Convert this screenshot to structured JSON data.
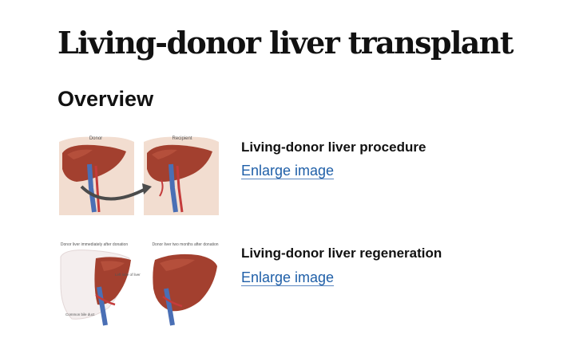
{
  "page": {
    "title": "Living-donor liver transplant",
    "section_heading": "Overview"
  },
  "figures": [
    {
      "caption": "Living-donor liver procedure",
      "link_label": "Enlarge image",
      "labels": [
        "Donor",
        "Recipient"
      ]
    },
    {
      "caption": "Living-donor liver regeneration",
      "link_label": "Enlarge image",
      "labels": [
        "Donor liver immediately after donation",
        "Donor liver two months after donation",
        "Left lobe of liver",
        "Common bile duct"
      ]
    }
  ],
  "colors": {
    "link": "#1f5fa8",
    "liver": "#a3402f",
    "liver_highlight": "#c25a44",
    "vein": "#4a6fb5",
    "artery": "#c43b3b",
    "skin": "#f2ddd0"
  }
}
